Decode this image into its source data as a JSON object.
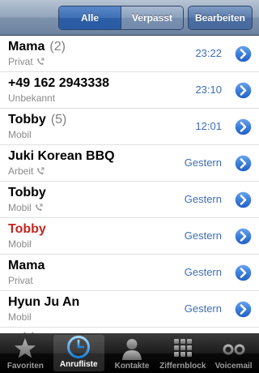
{
  "navbar": {
    "segments": [
      "Alle",
      "Verpasst"
    ],
    "selected_segment": "Alle",
    "edit_label": "Bearbeiten"
  },
  "calls": [
    {
      "name": "Mama",
      "count": "(2)",
      "type": "Privat",
      "phone_icon": true,
      "time": "23:22",
      "missed": false
    },
    {
      "name": "+49 162 2943338",
      "count": "",
      "type": "Unbekannt",
      "phone_icon": false,
      "time": "23:10",
      "missed": false
    },
    {
      "name": "Tobby",
      "count": "(5)",
      "type": "Mobil",
      "phone_icon": false,
      "time": "12:01",
      "missed": false
    },
    {
      "name": "Juki Korean BBQ",
      "count": "",
      "type": "Arbeit",
      "phone_icon": true,
      "time": "Gestern",
      "missed": false
    },
    {
      "name": "Tobby",
      "count": "",
      "type": "Mobil",
      "phone_icon": true,
      "time": "Gestern",
      "missed": false
    },
    {
      "name": "Tobby",
      "count": "",
      "type": "Mobil",
      "phone_icon": false,
      "time": "Gestern",
      "missed": true
    },
    {
      "name": "Mama",
      "count": "",
      "type": "Privat",
      "phone_icon": false,
      "time": "Gestern",
      "missed": false
    },
    {
      "name": "Hyun Ju An",
      "count": "",
      "type": "Mobil",
      "phone_icon": false,
      "time": "Gestern",
      "missed": false
    },
    {
      "name": "Tobby",
      "count": "",
      "type": "",
      "phone_icon": false,
      "time": "",
      "missed": false
    }
  ],
  "tabbar": {
    "tabs": [
      {
        "label": "Favoriten",
        "icon": "star-icon",
        "active": false
      },
      {
        "label": "Anrufliste",
        "icon": "clock-icon",
        "active": true
      },
      {
        "label": "Kontakte",
        "icon": "contact-person-icon",
        "active": false
      },
      {
        "label": "Ziffernblock",
        "icon": "keypad-icon",
        "active": false
      },
      {
        "label": "Voicemail",
        "icon": "voicemail-icon",
        "active": false
      }
    ]
  },
  "colors": {
    "missed_call": "#c3261f",
    "time_text": "#3d6eb5",
    "disclosure": "#2f6fd1"
  }
}
